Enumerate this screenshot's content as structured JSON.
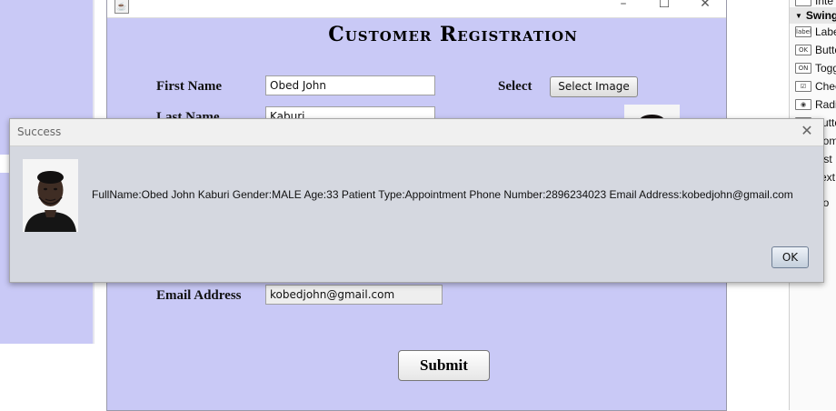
{
  "palette": {
    "header": "Swing",
    "items": [
      {
        "icon": "label",
        "label": "Label"
      },
      {
        "icon": "OK",
        "label": "Button"
      },
      {
        "icon": "ON",
        "label": "Toggle"
      },
      {
        "icon": "☑",
        "label": "Check"
      },
      {
        "icon": "◉",
        "label": "Radio"
      },
      {
        "icon": "◉",
        "label": "Button"
      },
      {
        "icon": "",
        "label": "Combo"
      },
      {
        "icon": "",
        "label": "List"
      },
      {
        "icon": "",
        "label": "Text"
      },
      {
        "icon": "",
        "label": "Co"
      }
    ],
    "top_partial": "Inte"
  },
  "registration": {
    "title": "Customer Registration",
    "first_name_label": "First Name",
    "first_name_value": "Obed John",
    "last_name_label": "Last Name",
    "last_name_value": "Kaburi",
    "select_label": "Select",
    "select_image_button": "Select Image",
    "email_label": "Email Address",
    "email_value": "kobedjohn@gmail.com",
    "submit_label": "Submit"
  },
  "dialog": {
    "title": "Success",
    "message": "FullName:Obed John Kaburi Gender:MALE Age:33 Patient Type:Appointment Phone Number:2896234023 Email Address:kobedjohn@gmail.com",
    "ok_label": "OK"
  },
  "icons": {
    "close": "close-icon",
    "minimize": "minimize-icon",
    "maximize": "maximize-icon",
    "app": "java-app-icon"
  },
  "colors": {
    "form_background": "#c9c9f6",
    "dialog_background": "#d5d8e0"
  }
}
